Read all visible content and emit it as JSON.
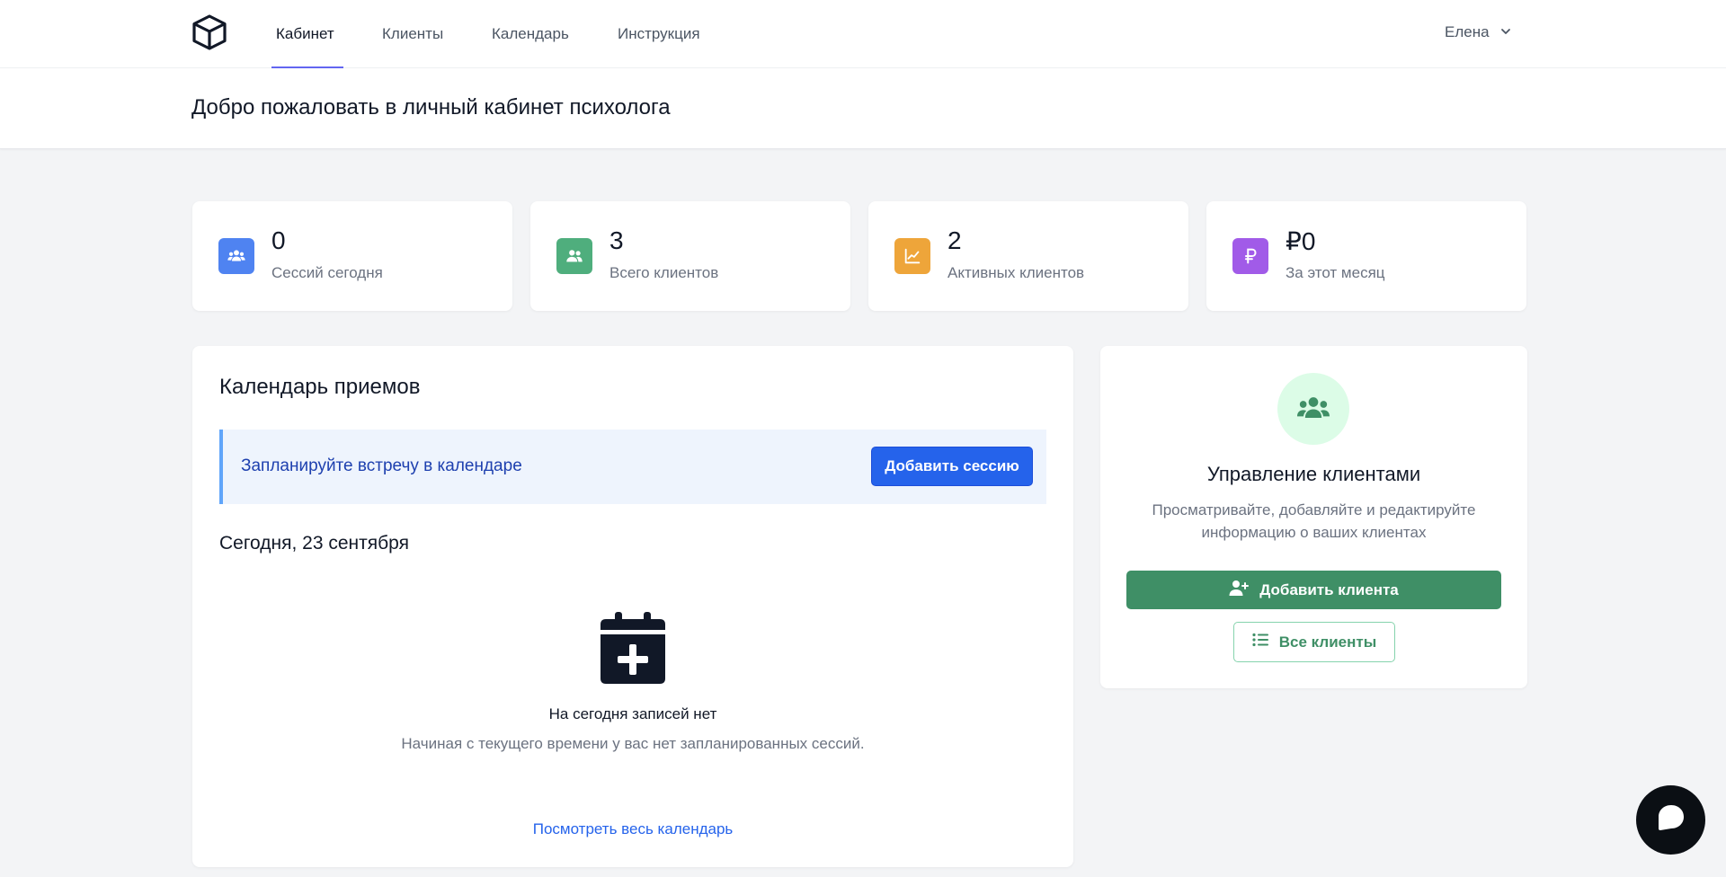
{
  "nav": {
    "items": [
      {
        "label": "Кабинет",
        "active": true
      },
      {
        "label": "Клиенты",
        "active": false
      },
      {
        "label": "Календарь",
        "active": false
      },
      {
        "label": "Инструкция",
        "active": false
      }
    ],
    "user_name": "Елена",
    "logo_icon": "cube-icon"
  },
  "header": {
    "title": "Добро пожаловать в личный кабинет психолога"
  },
  "stats": [
    {
      "value": "0",
      "label": "Сессий сегодня",
      "icon": "users-icon",
      "color": "#4f83f1"
    },
    {
      "value": "3",
      "label": "Всего клиентов",
      "icon": "user-group-icon",
      "color": "#4fae7d"
    },
    {
      "value": "2",
      "label": "Активных клиентов",
      "icon": "chart-line-icon",
      "color": "#eea53a"
    },
    {
      "value": "₽0",
      "label": "За этот месяц",
      "icon": "ruble-icon",
      "color": "#a15be8"
    }
  ],
  "calendar": {
    "title": "Календарь приемов",
    "banner_text": "Запланируйте встречу в календаре",
    "add_session_label": "Добавить сессию",
    "today_label": "Сегодня, 23 сентября",
    "empty_title": "На сегодня записей нет",
    "empty_subtitle": "Начиная с текущего времени у вас нет запланированных сессий.",
    "view_all_label": "Посмотреть весь календарь"
  },
  "clients": {
    "title": "Управление клиентами",
    "description": "Просматривайте, добавляйте и редактируйте информацию о ваших клиентах",
    "add_client_label": "Добавить клиента",
    "all_clients_label": "Все клиенты"
  },
  "colors": {
    "primary_blue": "#2563eb",
    "green": "#3f8f66",
    "nav_underline": "#6366f1",
    "background": "#f3f4f6"
  }
}
